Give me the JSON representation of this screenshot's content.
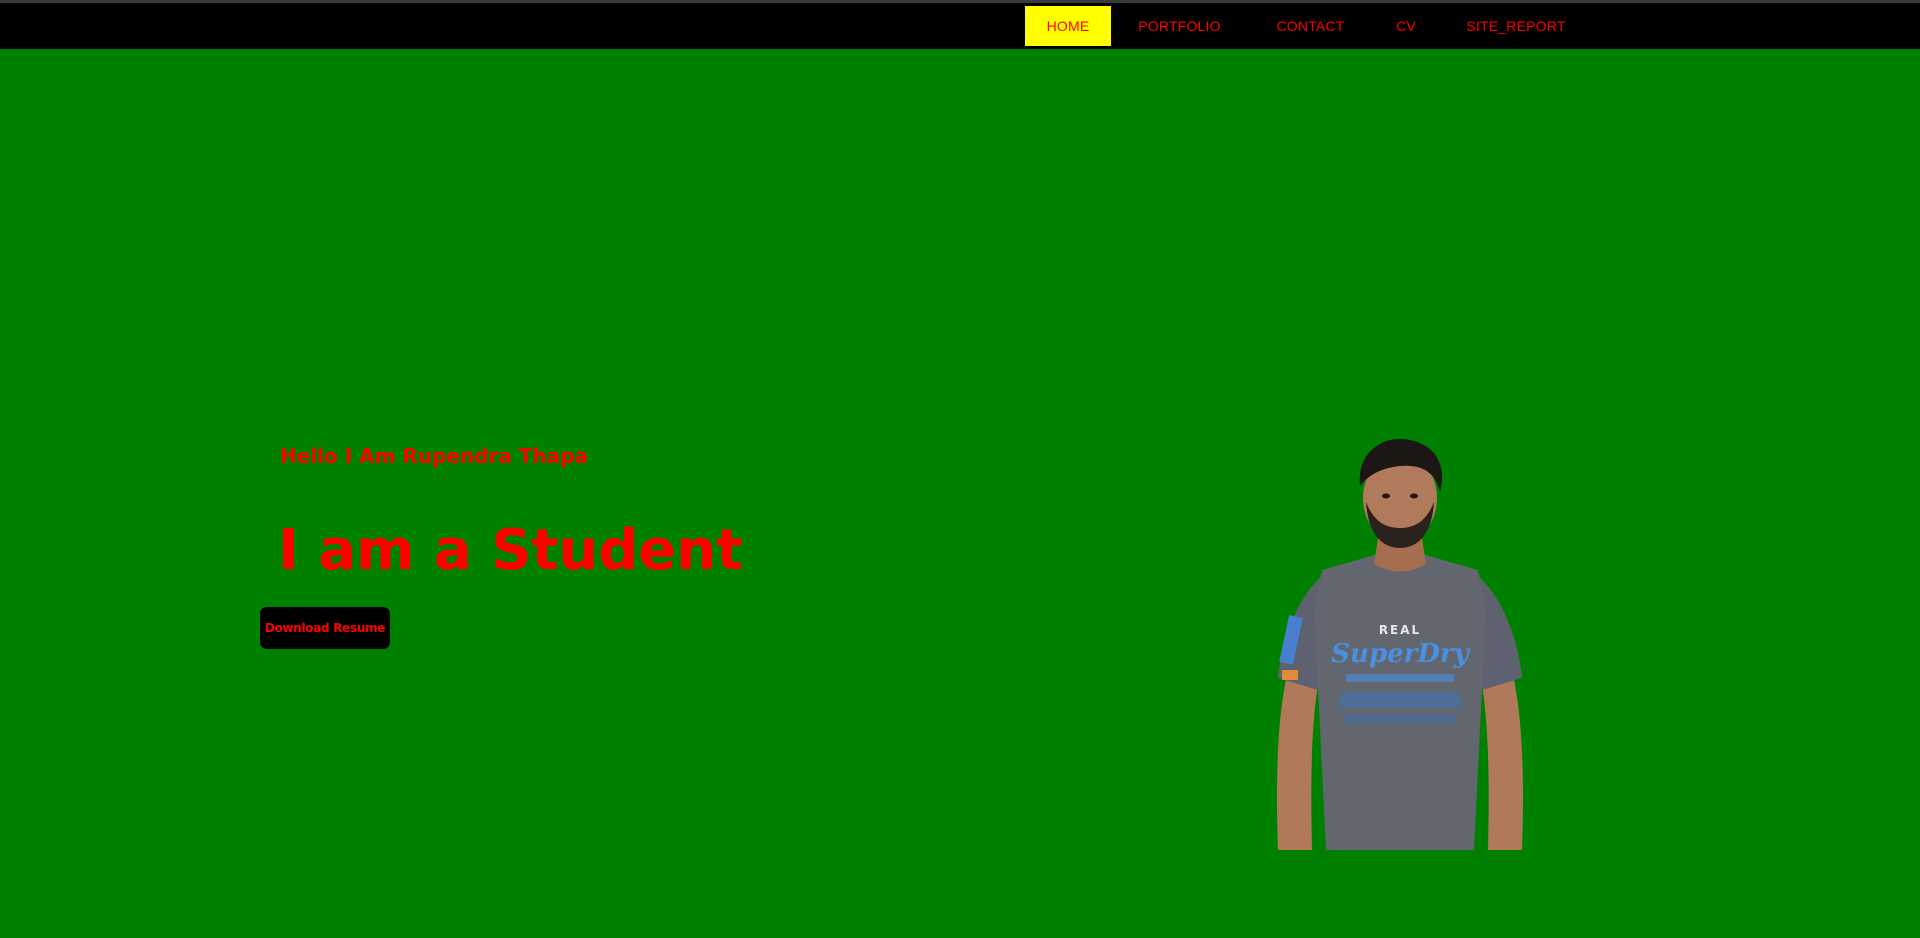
{
  "nav": {
    "items": [
      {
        "label": "HOME",
        "active": true
      },
      {
        "label": "PORTFOLIO",
        "active": false
      },
      {
        "label": "CONTACT",
        "active": false
      },
      {
        "label": "CV",
        "active": false
      },
      {
        "label": "SITE_REPORT",
        "active": false
      }
    ]
  },
  "hero": {
    "greeting": "Hello I Am Rupendra Thapa",
    "role": "I am a Student",
    "download_label": "Download Resume",
    "shirt_text_top": "REAL",
    "shirt_text_brand": "SuperDry"
  },
  "colors": {
    "background": "#008000",
    "navbar": "#000000",
    "text_accent": "#ff0000",
    "active_nav_bg": "#ffff00",
    "button_bg": "#000000"
  }
}
